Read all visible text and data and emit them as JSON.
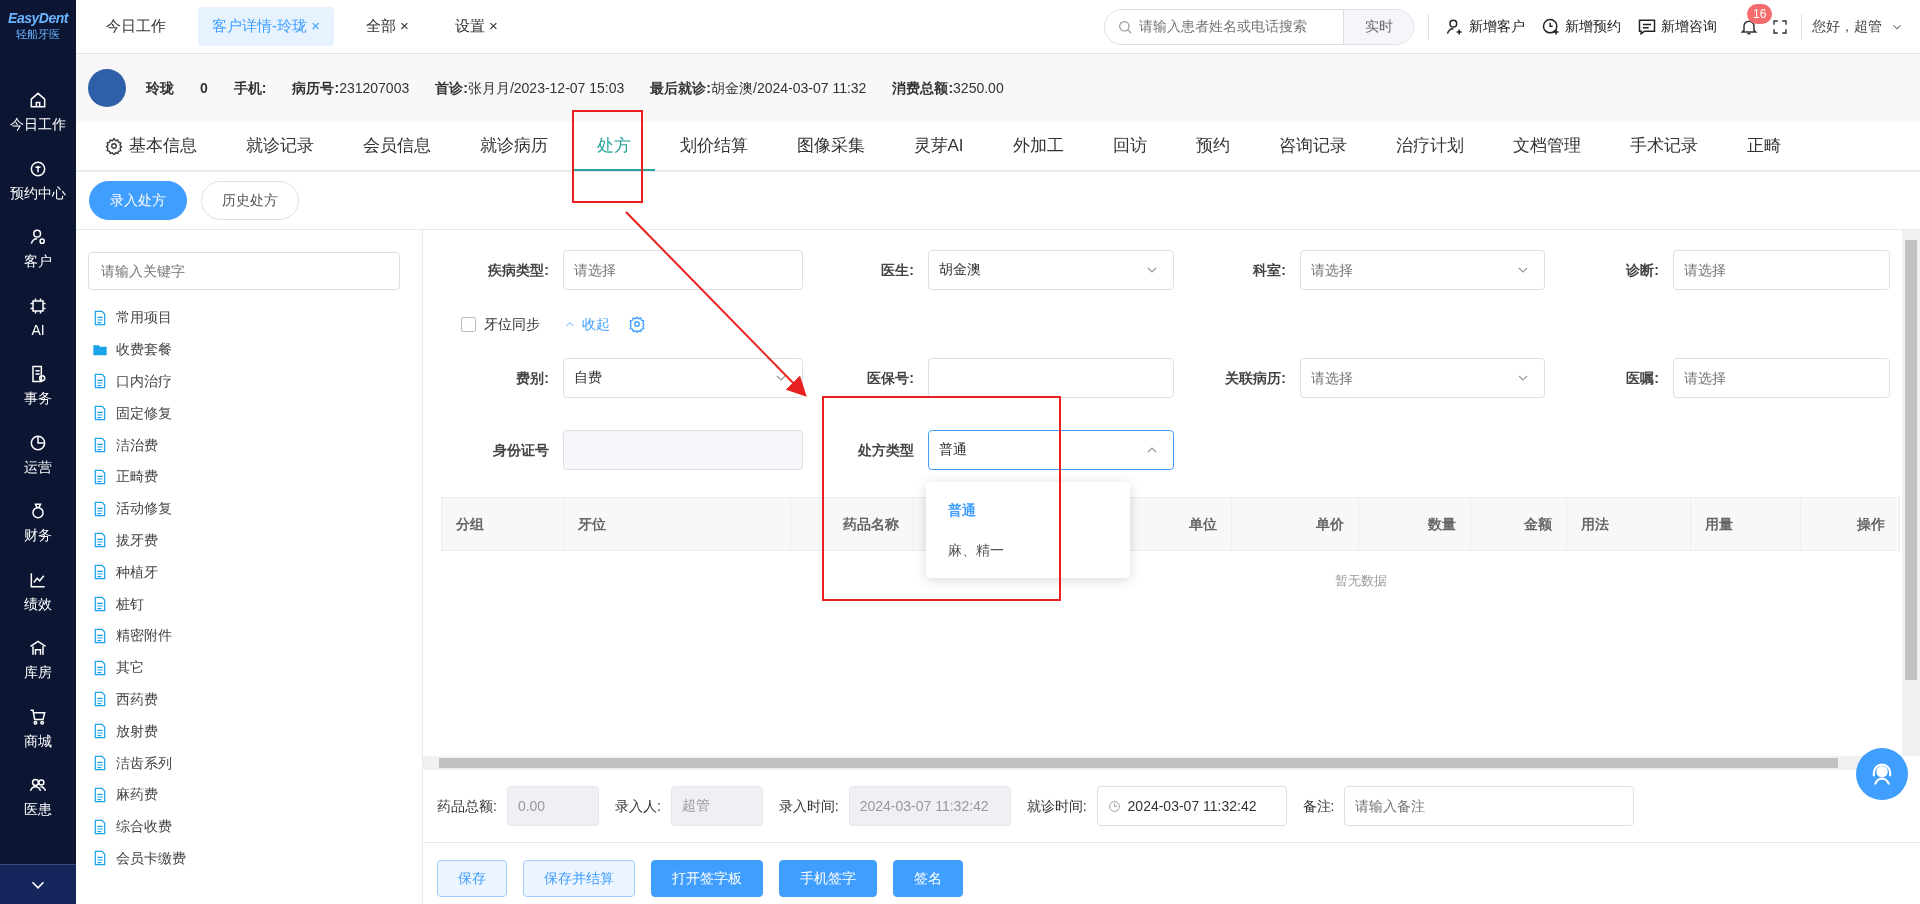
{
  "logo": {
    "name": "EasyDent",
    "subtitle": "轻船牙医"
  },
  "nav": [
    {
      "label": "今日工作"
    },
    {
      "label": "预约中心"
    },
    {
      "label": "客户"
    },
    {
      "label": "AI"
    },
    {
      "label": "事务"
    },
    {
      "label": "运营"
    },
    {
      "label": "财务"
    },
    {
      "label": "绩效"
    },
    {
      "label": "库房"
    },
    {
      "label": "商城"
    },
    {
      "label": "医患"
    }
  ],
  "top_tabs": [
    {
      "label": "今日工作",
      "selected": false
    },
    {
      "label": "客户详情-玲珑",
      "selected": true,
      "close": "×"
    },
    {
      "label": "全部",
      "selected": false,
      "close": "×"
    },
    {
      "label": "设置",
      "selected": false,
      "close": "×"
    }
  ],
  "search": {
    "placeholder": "请输入患者姓名或电话搜索",
    "button": "实时"
  },
  "actions": [
    {
      "label": "新增客户"
    },
    {
      "label": "新增预约"
    },
    {
      "label": "新增咨询"
    }
  ],
  "notifications": {
    "count": "16"
  },
  "user": {
    "greeting": "您好，超管"
  },
  "patient": {
    "name": "玲珑",
    "count": "0",
    "fields": [
      "**手机:**",
      "**病历号:**231207003",
      "**首诊:**张月月/2023-12-07 15:03",
      "**最后就诊:**胡金澳/2024-03-07 11:32",
      "**消费总额:**3250.00"
    ]
  },
  "record_tabs": [
    {
      "label": "基本信息",
      "selected": false
    },
    {
      "label": "就诊记录",
      "selected": false
    },
    {
      "label": "会员信息",
      "selected": false
    },
    {
      "label": "就诊病历",
      "selected": false
    },
    {
      "label": "处方",
      "selected": true
    },
    {
      "label": "划价结算",
      "selected": false
    },
    {
      "label": "图像采集",
      "selected": false
    },
    {
      "label": "灵芽AI",
      "selected": false
    },
    {
      "label": "外加工",
      "selected": false
    },
    {
      "label": "回访",
      "selected": false
    },
    {
      "label": "预约",
      "selected": false
    },
    {
      "label": "咨询记录",
      "selected": false
    },
    {
      "label": "治疗计划",
      "selected": false
    },
    {
      "label": "文档管理",
      "selected": false
    },
    {
      "label": "手术记录",
      "selected": false
    },
    {
      "label": "正畸",
      "selected": false
    }
  ],
  "sub_tabs": [
    {
      "label": "录入处方",
      "selected": true
    },
    {
      "label": "历史处方",
      "selected": false
    }
  ],
  "tree": {
    "placeholder": "请输入关键字",
    "items": [
      {
        "label": "常用项目",
        "kind": "file"
      },
      {
        "label": "收费套餐",
        "kind": "folder"
      },
      {
        "label": "口内治疗",
        "kind": "file"
      },
      {
        "label": "固定修复",
        "kind": "file"
      },
      {
        "label": "洁治费",
        "kind": "file"
      },
      {
        "label": "正畸费",
        "kind": "file"
      },
      {
        "label": "活动修复",
        "kind": "file"
      },
      {
        "label": "拔牙费",
        "kind": "file"
      },
      {
        "label": "种植牙",
        "kind": "file"
      },
      {
        "label": "桩钉",
        "kind": "file"
      },
      {
        "label": "精密附件",
        "kind": "file"
      },
      {
        "label": "其它",
        "kind": "file"
      },
      {
        "label": "西药费",
        "kind": "file"
      },
      {
        "label": "放射费",
        "kind": "file"
      },
      {
        "label": "洁齿系列",
        "kind": "file"
      },
      {
        "label": "麻药费",
        "kind": "file"
      },
      {
        "label": "综合收费",
        "kind": "file"
      },
      {
        "label": "会员卡缴费",
        "kind": "file"
      }
    ]
  },
  "form": {
    "row_1": [
      {
        "label": "疾病类型:",
        "kind": "input",
        "placeholder": "请选择"
      },
      {
        "label": "医生:",
        "kind": "select",
        "value": "胡金澳"
      },
      {
        "label": "科室:",
        "kind": "select",
        "placeholder": "请选择"
      },
      {
        "label": "诊断:",
        "kind": "input",
        "placeholder": "请选择"
      }
    ],
    "sync": {
      "label": "牙位同步",
      "checked": false
    },
    "collapse": {
      "label": "收起",
      "expanded": true
    },
    "row_2": [
      {
        "label": "费别:",
        "kind": "select",
        "value": "自费"
      },
      {
        "label": "医保号:",
        "kind": "input"
      },
      {
        "label": "关联病历:",
        "kind": "select",
        "placeholder": "请选择"
      },
      {
        "label": "医嘱:",
        "kind": "input",
        "placeholder": "请选择"
      }
    ],
    "row_3": [
      {
        "label": "身份证号",
        "kind": "disabled"
      },
      {
        "label": "处方类型",
        "kind": "select",
        "value": "普通",
        "open": true
      }
    ]
  },
  "dropdown": {
    "options": [
      {
        "label": "普通",
        "selected": true
      },
      {
        "label": "麻、精一",
        "selected": false
      }
    ]
  },
  "table": {
    "columns": [
      "分组",
      "牙位",
      "药品名称",
      "单位",
      "单价",
      "数量",
      "金额",
      "用法",
      "用量",
      "操作"
    ],
    "empty": "暂无数据"
  },
  "footer": {
    "fields": [
      {
        "label": "药品总额:",
        "value": "0.00",
        "disabled": true
      },
      {
        "label": "录入人:",
        "value": "超管",
        "disabled": true
      },
      {
        "label": "录入时间:",
        "value": "2024-03-07 11:32:42",
        "disabled": true
      },
      {
        "label": "就诊时间:",
        "value": "2024-03-07 11:32:42",
        "disabled": false,
        "kind": "datetime"
      },
      {
        "label": "备注:",
        "placeholder": "请输入备注",
        "disabled": false
      }
    ]
  },
  "buttons": [
    {
      "label": "保存",
      "kind": "light"
    },
    {
      "label": "保存并结算",
      "kind": "light"
    },
    {
      "label": "打开签字板",
      "kind": "primary"
    },
    {
      "label": "手机签字",
      "kind": "primary"
    },
    {
      "label": "签名",
      "kind": "primary"
    }
  ],
  "annotations": [
    {
      "kind": "frame"
    },
    {
      "kind": "arrow"
    },
    {
      "kind": "frame"
    }
  ]
}
